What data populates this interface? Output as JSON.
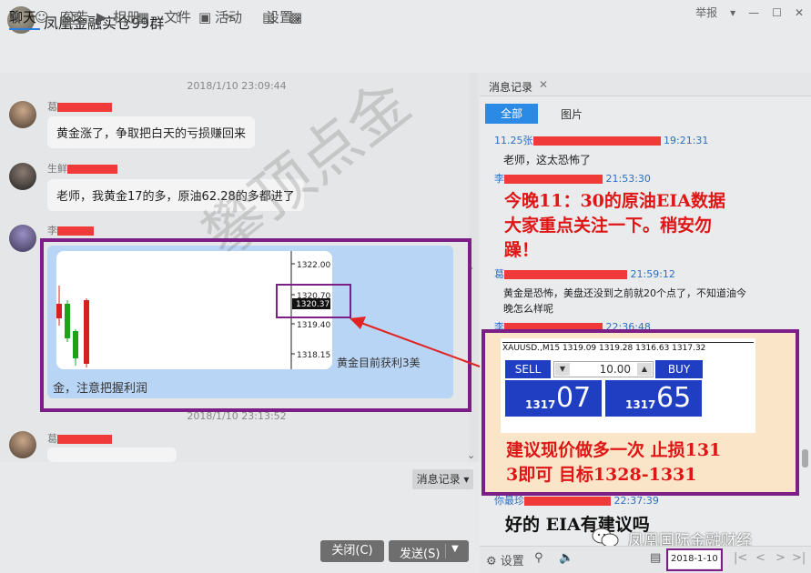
{
  "window": {
    "title": "凤凰金融实仓99群",
    "report_label": "举报",
    "controls": [
      "minimize",
      "maximize",
      "close"
    ]
  },
  "tabs": [
    {
      "label": "聊天",
      "active": true
    },
    {
      "label": "公告",
      "active": false
    },
    {
      "label": "相册",
      "active": false
    },
    {
      "label": "文件",
      "active": false
    },
    {
      "label": "活动",
      "active": false
    },
    {
      "label": "设置",
      "active": false,
      "dropdown": true
    }
  ],
  "chat": {
    "timestamps": [
      "2018/1/10 23:09:44",
      "2018/1/10 23:13:52"
    ],
    "messages": [
      {
        "sender": "葛",
        "text": "黄金涨了，争取把白天的亏损赚回来"
      },
      {
        "sender": "生鲜",
        "text": "老师，我黄金17的多，原油62.28的多都进了"
      },
      {
        "sender": "李",
        "text": ""
      },
      {
        "sender": "葛",
        "text": ""
      }
    ],
    "image_message": {
      "right_caption": "黄金目前获利3美",
      "bottom_caption": "金，注意把握利润",
      "price_axis": [
        "1322.00",
        "1320.70",
        "1320.37",
        "1319.40",
        "1318.15"
      ]
    },
    "watermark": "攀顶点金"
  },
  "toolbar": {
    "history_button": "消息记录",
    "close_button": "关闭(C)",
    "send_button": "发送(S)"
  },
  "history_panel": {
    "tab_label": "消息记录",
    "filter_all": "全部",
    "filter_images": "图片",
    "entries": [
      {
        "name": "11.25张",
        "time": "19:21:31",
        "text": "老师，这太恐怖了"
      },
      {
        "name": "李",
        "time": "21:53:30",
        "text": "今晚11：30的原油EIA数据大家重点关注一下。稍安勿躁！"
      },
      {
        "name": "葛",
        "time": "21:59:12",
        "text": "黄金是恐怖，美盘还没到之前就20个点了，不知道油今晚怎么样呢"
      },
      {
        "name": "李",
        "time": "22:36:48",
        "text": "建议现价做多一次 止损1313即可 目标1328-1331"
      },
      {
        "name": "你最珍",
        "time": "22:37:39",
        "text": "好的 EIA有建议吗"
      }
    ],
    "red_text_line1": "今晚11：30的原油EIA数据",
    "red_text_line2": "大家重点关注一下。稍安勿",
    "red_text_line3": "躁！",
    "red_advice_line1": "建议现价做多一次 止损131",
    "red_advice_line2": "3即可  目标1328-1331",
    "black_big_text": "好的 EIA有建议吗",
    "trade_widget": {
      "header": "XAUUSD.,M15  1319.09 1319.28 1316.63 1317.32",
      "sell_label": "SELL",
      "buy_label": "BUY",
      "lot": "10.00",
      "sell_small": "1317",
      "sell_big": "07",
      "buy_small": "1317",
      "buy_big": "65"
    },
    "footer": {
      "settings_label": "设置",
      "date": "2018-1-10"
    },
    "overlay_watermark": "凤凰国际金融财经"
  }
}
